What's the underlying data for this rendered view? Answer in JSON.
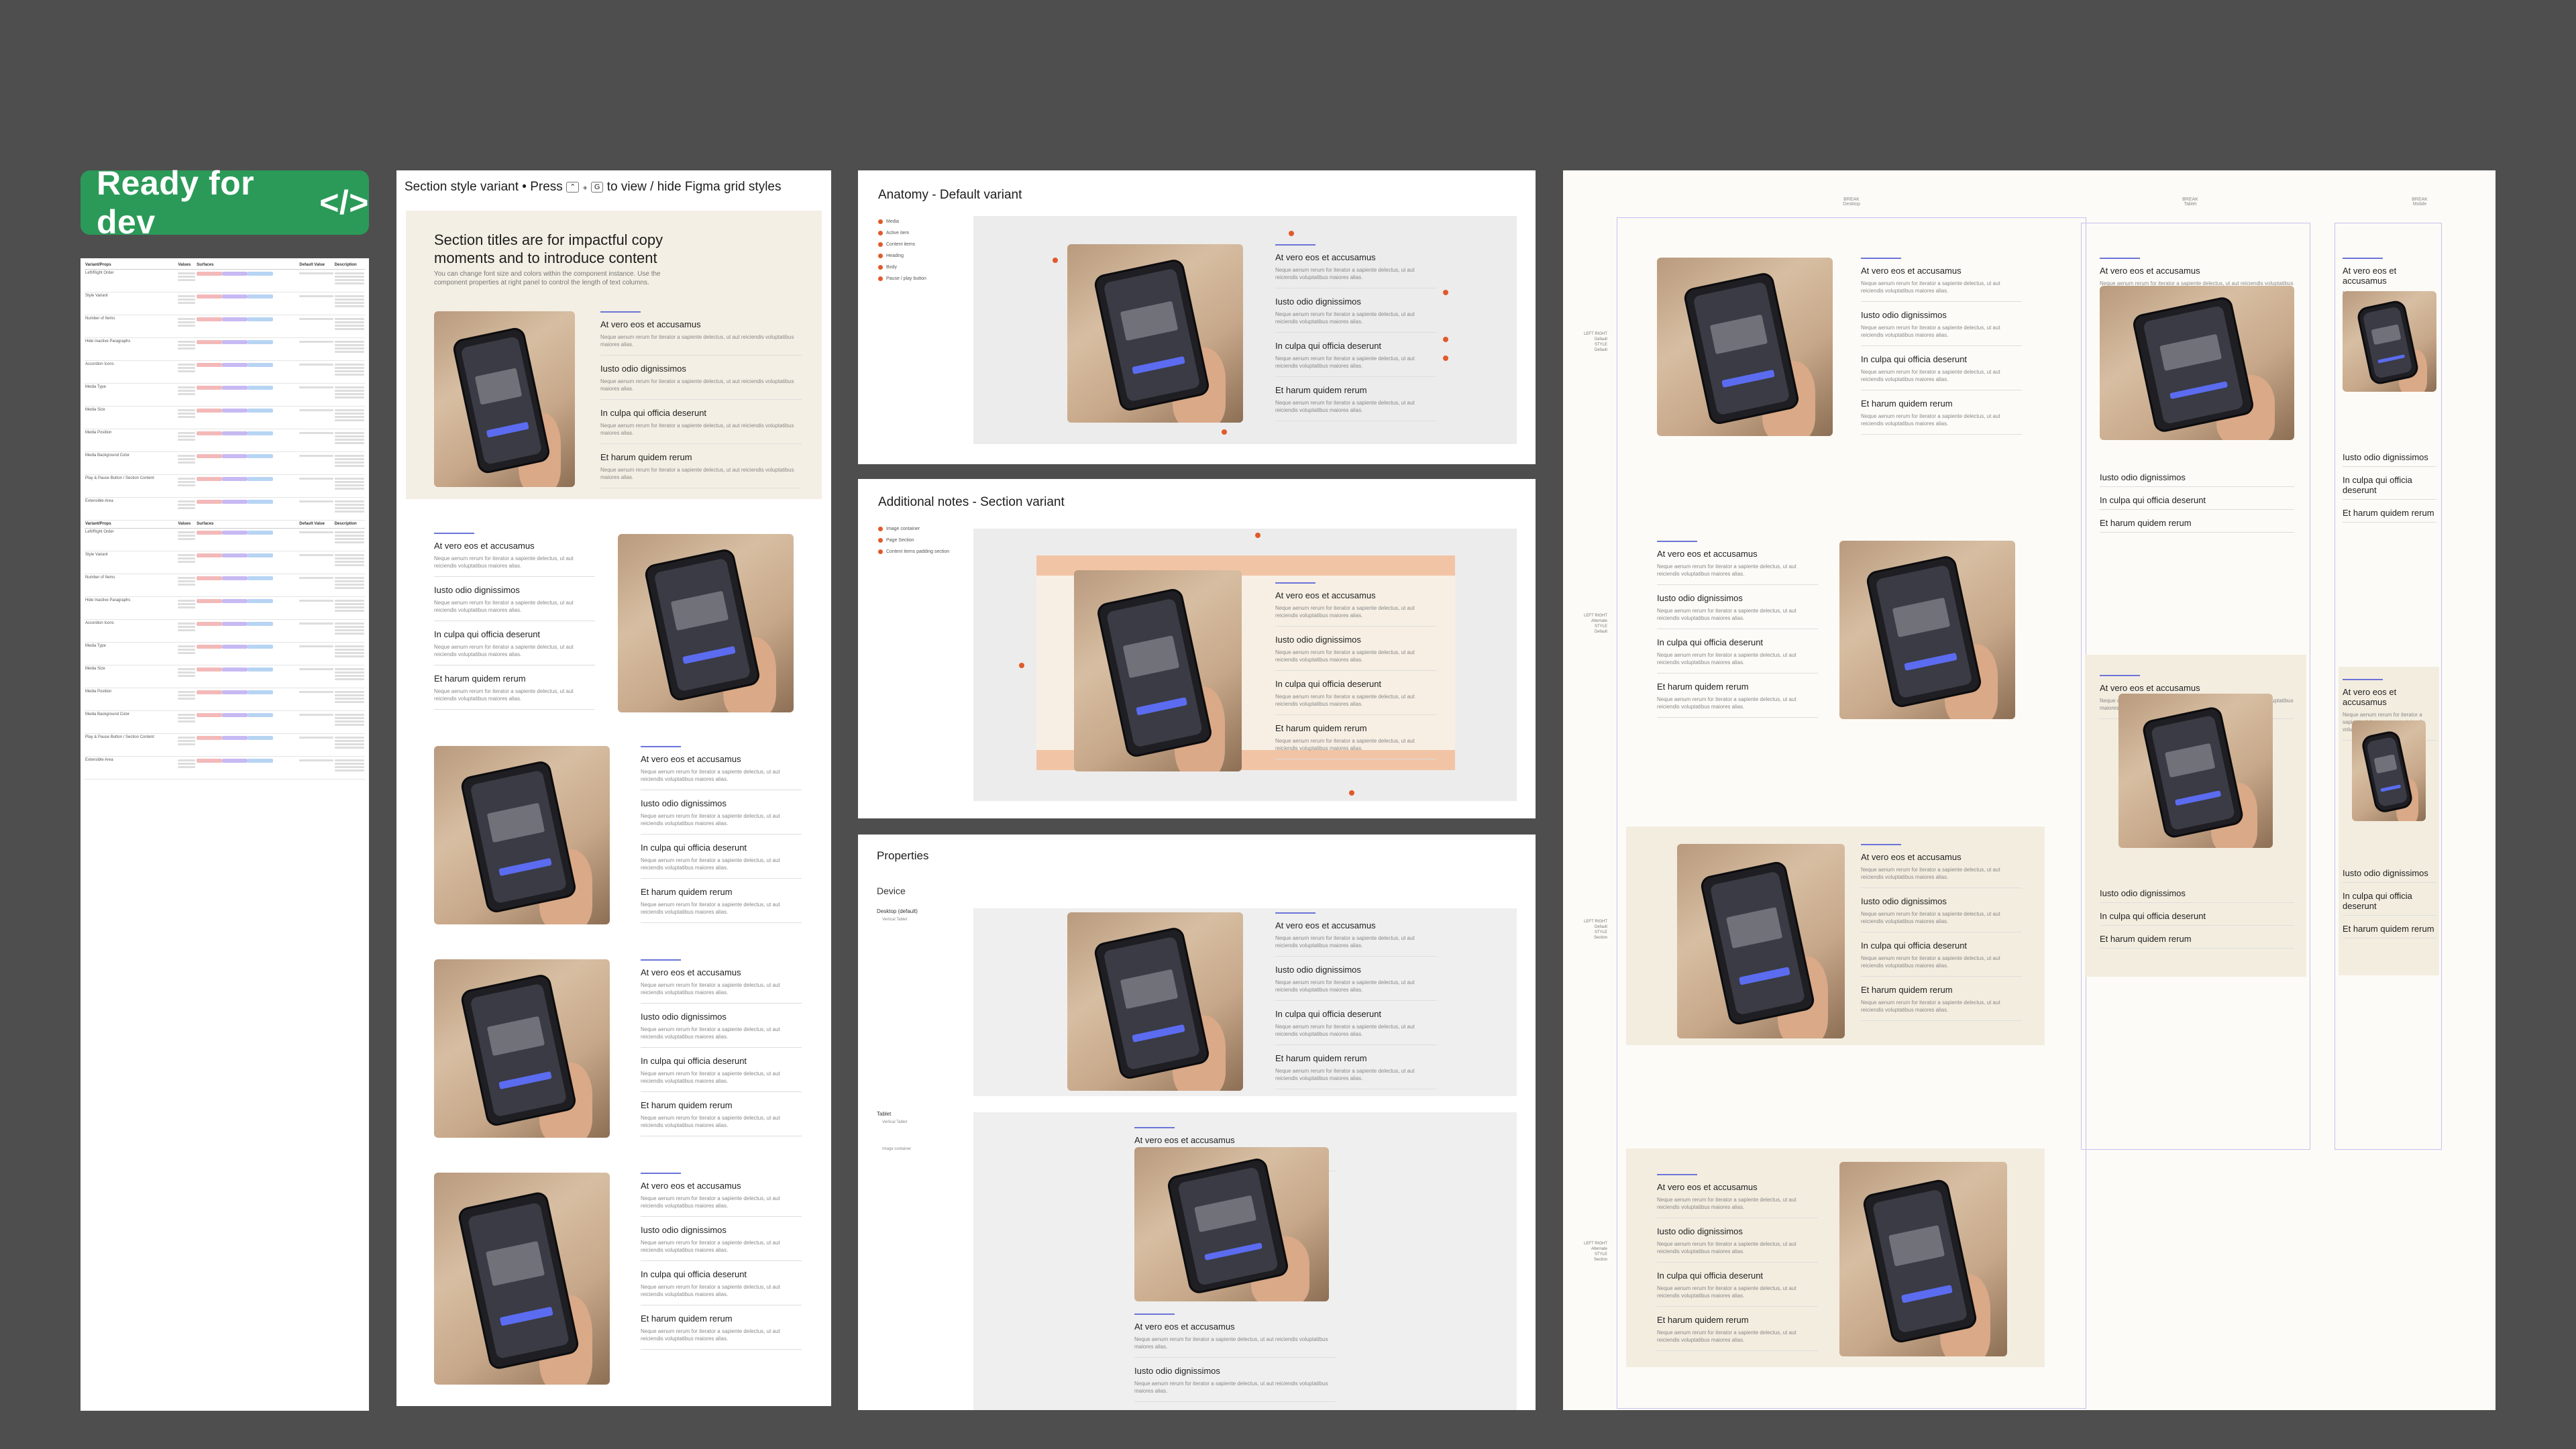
{
  "badge": {
    "label": "Ready for dev",
    "icon": "code-icon",
    "code_glyph": "</>",
    "color": "#2b9a58"
  },
  "props_table": {
    "headers": [
      "Variant/Props",
      "Values",
      "Surfaces",
      "Default Value",
      "Description"
    ],
    "rows": [
      "Left/Right Order",
      "Style Variant",
      "Number of Items",
      "Hide Inactive Paragraphs",
      "Accordion Icons",
      "Media Type",
      "Media Size",
      "Media Position",
      "Media Background Color",
      "Play & Pause Button / Section Content",
      "Extensible Area"
    ]
  },
  "section_frame": {
    "title": "Section style variant • Press",
    "keys": [
      "⌃",
      "G"
    ],
    "title_suffix": "to view / hide Figma grid styles",
    "hero_title": "Section titles are for impactful copy moments and to introduce content",
    "hero_sub": "You can change font size and colors within the component instance. Use the component properties at right panel to control the length of text columns."
  },
  "accordion": {
    "items": [
      "At vero eos et accusamus",
      "Iusto odio dignissimos",
      "In culpa qui officia deserunt",
      "Et harum quidem rerum"
    ],
    "desc": "Neque aenum rerum for iterator a sapiente delectus, ut aut reiciendis voluptatibus maiores alias."
  },
  "anatomy": {
    "title": "Anatomy - Default variant",
    "items": [
      "Media",
      "Active item",
      "Content items",
      "Heading",
      "Body",
      "Pause / play button"
    ]
  },
  "notes": {
    "title": "Additional notes - Section variant",
    "items": [
      "Image container",
      "Page Section",
      "Content items padding section"
    ]
  },
  "properties": {
    "title": "Properties",
    "device": "Device",
    "desktop_label": "Desktop (default)",
    "desktop_sub": "Vertical Tablet",
    "tablet_label": "Tablet",
    "tablet_sub": "Vertical Tablet",
    "tablet_note": "Image container"
  },
  "responsive": {
    "columns": [
      "Desktop",
      "Tablet",
      "Mobile"
    ],
    "col_kicker": "BREAK",
    "row_labels": [
      [
        "LEFT RIGHT",
        "Default",
        "STYLE",
        "Default"
      ],
      [
        "LEFT RIGHT",
        "Alternate",
        "STYLE",
        "Default"
      ],
      [
        "LEFT RIGHT",
        "Default",
        "STYLE",
        "Section"
      ],
      [
        "LEFT RIGHT",
        "Alternate",
        "STYLE",
        "Section"
      ]
    ]
  }
}
